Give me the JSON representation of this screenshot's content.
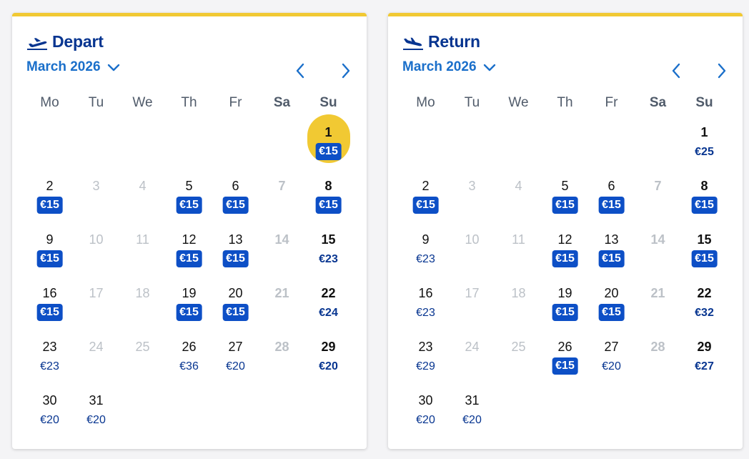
{
  "weekdays": [
    "Mo",
    "Tu",
    "We",
    "Th",
    "Fr",
    "Sa",
    "Su"
  ],
  "colors": {
    "accent": "#f1c933",
    "title": "#073590",
    "link": "#1a6fca",
    "badge": "#0d4fc6",
    "unavailable": "#bcc1c7"
  },
  "calendars": [
    {
      "id": "depart",
      "title": "Depart",
      "icon": "plane-takeoff-icon",
      "month": "March 2026",
      "weeks": [
        [
          null,
          null,
          null,
          null,
          null,
          null,
          {
            "day": "1",
            "price": "€15",
            "badge": true,
            "weekend": true,
            "selected": true
          }
        ],
        [
          {
            "day": "2",
            "price": "€15",
            "badge": true
          },
          {
            "day": "3",
            "available": false
          },
          {
            "day": "4",
            "available": false
          },
          {
            "day": "5",
            "price": "€15",
            "badge": true
          },
          {
            "day": "6",
            "price": "€15",
            "badge": true
          },
          {
            "day": "7",
            "available": false,
            "weekend": true
          },
          {
            "day": "8",
            "price": "€15",
            "badge": true,
            "weekend": true
          }
        ],
        [
          {
            "day": "9",
            "price": "€15",
            "badge": true
          },
          {
            "day": "10",
            "available": false
          },
          {
            "day": "11",
            "available": false
          },
          {
            "day": "12",
            "price": "€15",
            "badge": true
          },
          {
            "day": "13",
            "price": "€15",
            "badge": true
          },
          {
            "day": "14",
            "available": false,
            "weekend": true
          },
          {
            "day": "15",
            "price": "€23",
            "weekend": true
          }
        ],
        [
          {
            "day": "16",
            "price": "€15",
            "badge": true
          },
          {
            "day": "17",
            "available": false
          },
          {
            "day": "18",
            "available": false
          },
          {
            "day": "19",
            "price": "€15",
            "badge": true
          },
          {
            "day": "20",
            "price": "€15",
            "badge": true
          },
          {
            "day": "21",
            "available": false,
            "weekend": true
          },
          {
            "day": "22",
            "price": "€24",
            "weekend": true
          }
        ],
        [
          {
            "day": "23",
            "price": "€23"
          },
          {
            "day": "24",
            "available": false
          },
          {
            "day": "25",
            "available": false
          },
          {
            "day": "26",
            "price": "€36"
          },
          {
            "day": "27",
            "price": "€20"
          },
          {
            "day": "28",
            "available": false,
            "weekend": true
          },
          {
            "day": "29",
            "price": "€20",
            "weekend": true
          }
        ],
        [
          {
            "day": "30",
            "price": "€20"
          },
          {
            "day": "31",
            "price": "€20"
          },
          null,
          null,
          null,
          null,
          null
        ]
      ]
    },
    {
      "id": "return",
      "title": "Return",
      "icon": "plane-landing-icon",
      "month": "March 2026",
      "weeks": [
        [
          null,
          null,
          null,
          null,
          null,
          null,
          {
            "day": "1",
            "price": "€25",
            "weekend": true
          }
        ],
        [
          {
            "day": "2",
            "price": "€15",
            "badge": true
          },
          {
            "day": "3",
            "available": false
          },
          {
            "day": "4",
            "available": false
          },
          {
            "day": "5",
            "price": "€15",
            "badge": true
          },
          {
            "day": "6",
            "price": "€15",
            "badge": true
          },
          {
            "day": "7",
            "available": false,
            "weekend": true
          },
          {
            "day": "8",
            "price": "€15",
            "badge": true,
            "weekend": true
          }
        ],
        [
          {
            "day": "9",
            "price": "€23"
          },
          {
            "day": "10",
            "available": false
          },
          {
            "day": "11",
            "available": false
          },
          {
            "day": "12",
            "price": "€15",
            "badge": true
          },
          {
            "day": "13",
            "price": "€15",
            "badge": true
          },
          {
            "day": "14",
            "available": false,
            "weekend": true
          },
          {
            "day": "15",
            "price": "€15",
            "badge": true,
            "weekend": true
          }
        ],
        [
          {
            "day": "16",
            "price": "€23"
          },
          {
            "day": "17",
            "available": false
          },
          {
            "day": "18",
            "available": false
          },
          {
            "day": "19",
            "price": "€15",
            "badge": true
          },
          {
            "day": "20",
            "price": "€15",
            "badge": true
          },
          {
            "day": "21",
            "available": false,
            "weekend": true
          },
          {
            "day": "22",
            "price": "€32",
            "weekend": true
          }
        ],
        [
          {
            "day": "23",
            "price": "€29"
          },
          {
            "day": "24",
            "available": false
          },
          {
            "day": "25",
            "available": false
          },
          {
            "day": "26",
            "price": "€15",
            "badge": true
          },
          {
            "day": "27",
            "price": "€20"
          },
          {
            "day": "28",
            "available": false,
            "weekend": true
          },
          {
            "day": "29",
            "price": "€27",
            "weekend": true
          }
        ],
        [
          {
            "day": "30",
            "price": "€20"
          },
          {
            "day": "31",
            "price": "€20"
          },
          null,
          null,
          null,
          null,
          null
        ]
      ]
    }
  ]
}
